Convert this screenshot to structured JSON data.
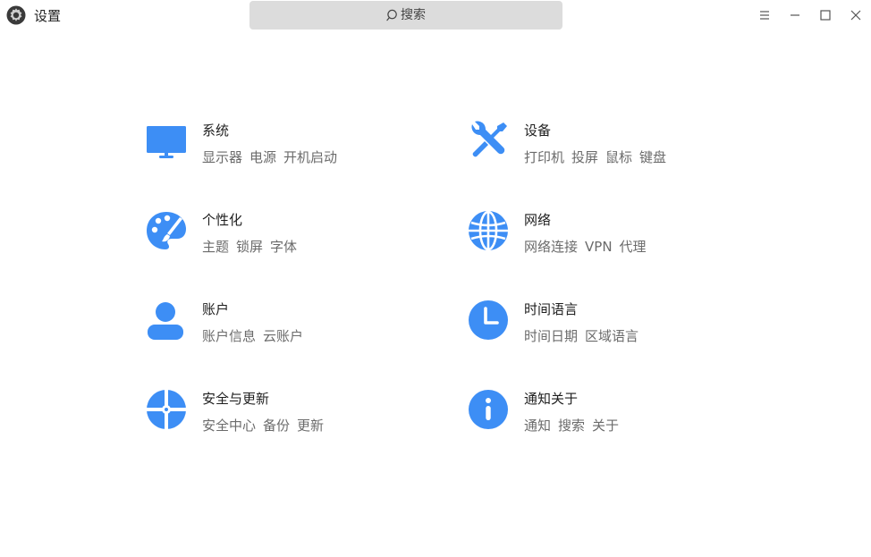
{
  "window": {
    "title": "设置",
    "search_placeholder": "搜索"
  },
  "colors": {
    "accent": "#3d8ef5",
    "search_bg": "#dcdcdc",
    "sub_text": "#6b6b6b"
  },
  "categories": [
    {
      "title": "系统",
      "icon": "monitor-icon",
      "subs": [
        "显示器",
        "电源",
        "开机启动"
      ]
    },
    {
      "title": "设备",
      "icon": "tools-icon",
      "subs": [
        "打印机",
        "投屏",
        "鼠标",
        "键盘"
      ]
    },
    {
      "title": "个性化",
      "icon": "palette-icon",
      "subs": [
        "主题",
        "锁屏",
        "字体"
      ]
    },
    {
      "title": "网络",
      "icon": "globe-icon",
      "subs": [
        "网络连接",
        "VPN",
        "代理"
      ]
    },
    {
      "title": "账户",
      "icon": "user-icon",
      "subs": [
        "账户信息",
        "云账户"
      ]
    },
    {
      "title": "时间语言",
      "icon": "clock-icon",
      "subs": [
        "时间日期",
        "区域语言"
      ]
    },
    {
      "title": "安全与更新",
      "icon": "shield-icon",
      "subs": [
        "安全中心",
        "备份",
        "更新"
      ]
    },
    {
      "title": "通知关于",
      "icon": "info-icon",
      "subs": [
        "通知",
        "搜索",
        "关于"
      ]
    }
  ]
}
